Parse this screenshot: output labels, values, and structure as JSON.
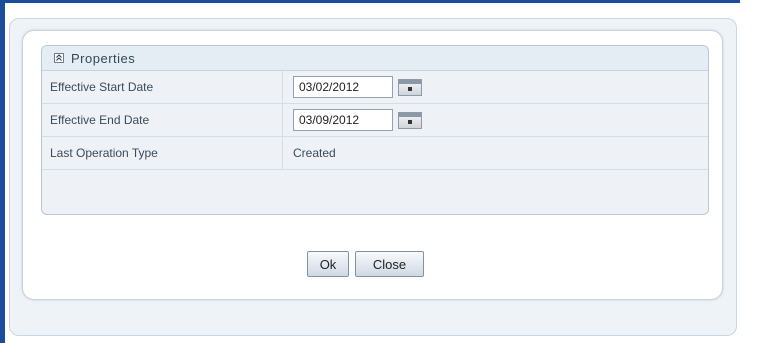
{
  "panel": {
    "title": "Properties"
  },
  "fields": {
    "start_date": {
      "label": "Effective Start Date",
      "value": "03/02/2012"
    },
    "end_date": {
      "label": "Effective End Date",
      "value": "03/09/2012"
    },
    "operation_type": {
      "label": "Last Operation Type",
      "value": "Created"
    }
  },
  "buttons": {
    "ok": "Ok",
    "close": "Close"
  },
  "icons": {
    "collapse": "collapse-icon",
    "calendar": "calendar-icon"
  },
  "colors": {
    "window_border": "#1c4c9c",
    "panel_bg": "#eef2f6"
  }
}
